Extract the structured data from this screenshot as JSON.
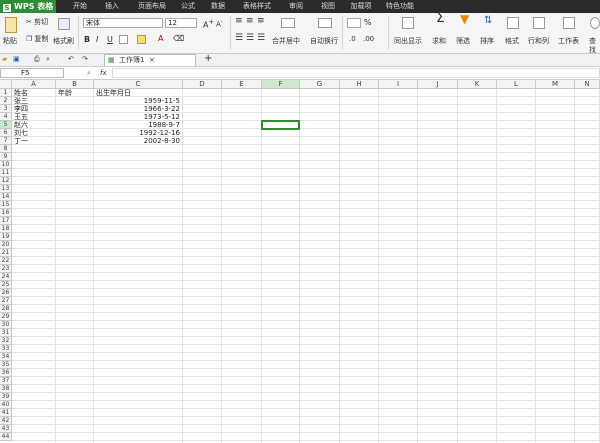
{
  "app": {
    "logo": "WPS 表格",
    "logo_mark": "S"
  },
  "menu_tabs": [
    "开始",
    "插入",
    "页面布局",
    "公式",
    "数据",
    "表格样式",
    "审阅",
    "视图",
    "加载项",
    "特色功能"
  ],
  "ribbon": {
    "cut": "剪切",
    "copy": "复制",
    "paste": "粘贴",
    "format_painter": "格式刷",
    "font_name": "宋体",
    "font_size": "12",
    "bold": "B",
    "italic": "I",
    "underline": "U",
    "merge_center": "合并居中",
    "wrap": "自动换行",
    "percent": "%",
    "cond_format": "同出显示",
    "sum": "求和",
    "filter": "筛选",
    "sort": "排序",
    "format": "格式",
    "row_col": "行和列",
    "worksheet": "工作表",
    "find": "查找"
  },
  "doc_tab": "工作簿1",
  "formula_bar": {
    "name_box": "F5",
    "fx": "fx",
    "value": ""
  },
  "columns": [
    "A",
    "B",
    "C",
    "D",
    "E",
    "F",
    "G",
    "H",
    "I",
    "J",
    "K",
    "L",
    "M",
    "N"
  ],
  "selected_column": "F",
  "selected_row": 5,
  "rows": [
    {
      "A": "姓名",
      "B": "年龄",
      "C": "出生年月日"
    },
    {
      "A": "张三",
      "B": "",
      "C": "1959-11-5"
    },
    {
      "A": "李四",
      "B": "",
      "C": "1966-3-22"
    },
    {
      "A": "王五",
      "B": "",
      "C": "1973-5-12"
    },
    {
      "A": "赵六",
      "B": "",
      "C": "1988-9-7"
    },
    {
      "A": "刘七",
      "B": "",
      "C": "1992-12-16"
    },
    {
      "A": "丁一",
      "B": "",
      "C": "2002-8-30"
    }
  ],
  "row_count": 44,
  "colors": {
    "accent": "#2e8b36",
    "menubar": "#2b2b2b",
    "selection": "#2f8a2f"
  }
}
